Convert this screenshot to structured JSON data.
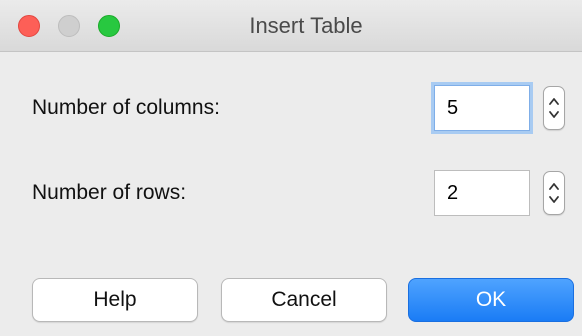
{
  "window": {
    "title": "Insert Table"
  },
  "form": {
    "columns_label": "Number of columns:",
    "columns_value": "5",
    "rows_label": "Number of rows:",
    "rows_value": "2"
  },
  "buttons": {
    "help": "Help",
    "cancel": "Cancel",
    "ok": "OK"
  },
  "colors": {
    "close": "#fd5f57",
    "minimize": "#cfcfcf",
    "zoom": "#28c840",
    "primary": "#1a7cf5",
    "focus_ring": "#a8cbf2"
  },
  "icons": {
    "stepper": "up-down-chevron-icon"
  }
}
